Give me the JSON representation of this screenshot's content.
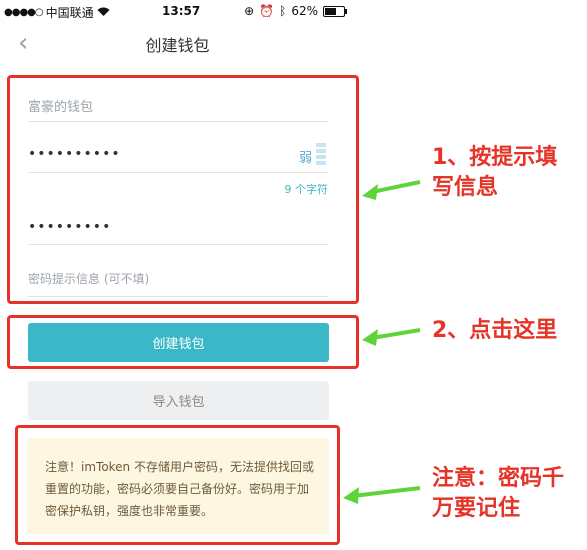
{
  "status_bar": {
    "carrier": "中国联通",
    "time": "13:57",
    "battery": "62%",
    "battery_level": 0.62
  },
  "nav": {
    "title": "创建钱包"
  },
  "form": {
    "wallet_name": "富豪的钱包",
    "password_mask": "••••••••••",
    "strength": "弱",
    "char_count": "9 个字符",
    "confirm_mask": "•••••••••",
    "hint_placeholder": "密码提示信息 (可不填)"
  },
  "buttons": {
    "create": "创建钱包",
    "import": "导入钱包"
  },
  "notice": {
    "text": "注意！imToken 不存储用户密码，无法提供找回或重置的功能，密码必须要自己备份好。密码用于加密保护私钥，强度也非常重要。"
  },
  "annotations": {
    "step1": [
      "1、按提示填",
      "写信息"
    ],
    "step2": "2、点击这里",
    "note": [
      "注意：密码千",
      "万要记住"
    ],
    "colors": {
      "red": "#e53327",
      "arrow": "#5fd43a"
    }
  }
}
